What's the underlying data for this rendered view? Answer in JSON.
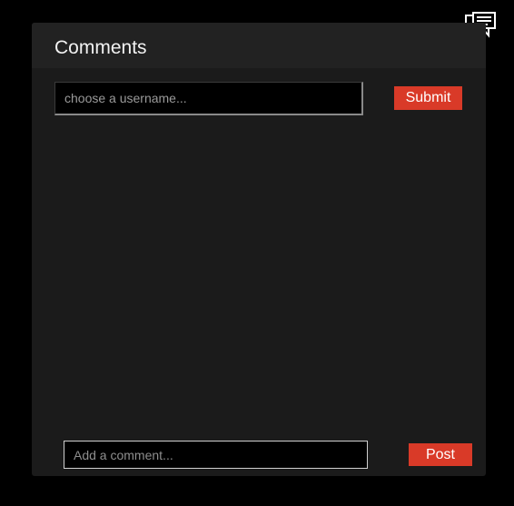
{
  "panel": {
    "title": "Comments"
  },
  "username": {
    "placeholder": "choose a username...",
    "value": ""
  },
  "submit_label": "Submit",
  "composer": {
    "placeholder": "Add a comment...",
    "value": ""
  },
  "post_label": "Post",
  "comments": [],
  "icons": {
    "toggle": "comments-toggle-icon"
  },
  "colors": {
    "accent": "#d93a28",
    "panel": "#1b1b1b",
    "header": "#222222",
    "background": "#000000"
  }
}
